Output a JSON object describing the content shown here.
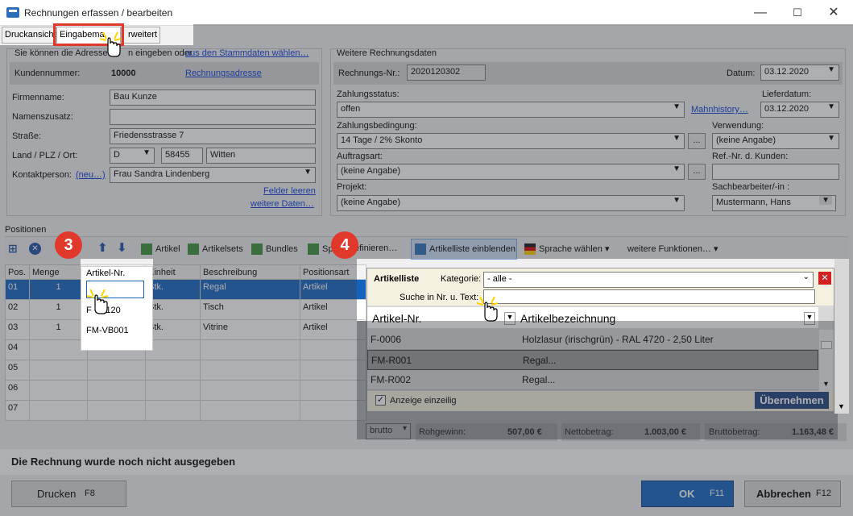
{
  "window": {
    "title": "Rechnungen erfassen / bearbeiten",
    "min": "—",
    "max": "☐",
    "close": "✕"
  },
  "tabs": [
    "Druckansicht",
    "Eingabemaske",
    "Erweitert"
  ],
  "tabs_visible": {
    "t1": "Druckansicht",
    "t2": "Eingabema",
    "t3": "rweitert"
  },
  "left": {
    "address_hint": "Sie können die Adresse",
    "address_hint2": "n eingeben oder",
    "stamm_link": "aus den Stammdaten wählen…",
    "kundennr_label": "Kundennummer:",
    "kundennr": "10000",
    "rechadr_link": "Rechnungsadresse",
    "firma_label": "Firmenname:",
    "firma": "Bau Kunze",
    "namenszusatz_label": "Namenszusatz:",
    "namenszusatz": "",
    "strasse_label": "Straße:",
    "strasse": "Friedensstrasse 7",
    "land_label": "Land / PLZ / Ort:",
    "land": "D",
    "plz": "58455",
    "ort": "Witten",
    "kontakt_label": "Kontaktperson:",
    "kontakt_link": "(neu…)",
    "kontakt": "Frau Sandra Lindenberg",
    "felder_leeren": "Felder leeren",
    "weitere_daten": "weitere Daten…"
  },
  "right": {
    "group_title": "Weitere Rechnungsdaten",
    "rechnr_label": "Rechnungs-Nr.:",
    "rechnr": "2020120302",
    "datum_label": "Datum:",
    "datum": "03.12.2020",
    "zahlstatus_label": "Zahlungsstatus:",
    "zahlstatus": "offen",
    "mahnhistory": "Mahnhistory…",
    "lieferdatum_label": "Lieferdatum:",
    "lieferdatum": "03.12.2020",
    "zahlbed_label": "Zahlungsbedingung:",
    "zahlbed": "14 Tage / 2% Skonto",
    "verwendung_label": "Verwendung:",
    "verwendung": "(keine Angabe)",
    "auftragsart_label": "Auftragsart:",
    "auftragsart": "(keine Angabe)",
    "refnr_label": "Ref.-Nr. d. Kunden:",
    "refnr": "",
    "projekt_label": "Projekt:",
    "projekt": "(keine Angabe)",
    "sachbearb_label": "Sachbearbeiter/-in :",
    "sachbearb": "Mustermann, Hans",
    "dots": "..."
  },
  "positions": {
    "title": "Positionen",
    "toolbar": {
      "artikel": "Artikel",
      "artikelsets": "Artikelsets",
      "bundles": "Bundles",
      "sp": "Sp",
      "definieren": "efinieren…",
      "artikelliste": "Artikelliste einblenden",
      "sprache": "Sprache wählen",
      "weitere": "weitere Funktionen…"
    },
    "columns": [
      "Pos.",
      "Menge",
      "Artikel-Nr.",
      "Einheit",
      "Beschreibung",
      "Positionsart"
    ],
    "rows": [
      {
        "pos": "01",
        "menge": "1",
        "artnr": "",
        "einheit": "Stk.",
        "beschr": "Regal",
        "art": "Artikel"
      },
      {
        "pos": "02",
        "menge": "1",
        "artnr": "F  -B-120",
        "einheit": "Stk.",
        "beschr": "Tisch",
        "art": "Artikel"
      },
      {
        "pos": "03",
        "menge": "1",
        "artnr": "FM-VB001",
        "einheit": "Stk.",
        "beschr": "Vitrine",
        "art": "Artikel"
      },
      {
        "pos": "04",
        "menge": "",
        "artnr": "",
        "einheit": "",
        "beschr": "",
        "art": ""
      },
      {
        "pos": "05",
        "menge": "",
        "artnr": "",
        "einheit": "",
        "beschr": "",
        "art": ""
      },
      {
        "pos": "06",
        "menge": "",
        "artnr": "",
        "einheit": "",
        "beschr": "",
        "art": ""
      },
      {
        "pos": "07",
        "menge": "",
        "artnr": "",
        "einheit": "",
        "beschr": "",
        "art": ""
      }
    ]
  },
  "artikelliste": {
    "title": "Artikelliste",
    "kategorie_label": "Kategorie:",
    "kategorie": "- alle -",
    "suche_label": "Suche in Nr. u. Text:",
    "suche": "",
    "col1": "Artikel-Nr.",
    "col2": "Artikelbezeichnung",
    "items": [
      {
        "nr": "F-0006",
        "bez": "Holzlasur (irischgrün) - RAL 4720 - 2,50 Liter"
      },
      {
        "nr": "FM-R001",
        "bez": "Regal..."
      },
      {
        "nr": "FM-R002",
        "bez": "Regal..."
      }
    ],
    "einzeln": "Anzeige einzeilig",
    "uebernehmen": "Übernehmen"
  },
  "totals": {
    "mode": "brutto",
    "rohgewinn_label": "Rohgewinn:",
    "rohgewinn": "507,00 €",
    "netto_label": "Nettobetrag:",
    "netto": "1.003,00 €",
    "brutto_label": "Bruttobetrag:",
    "brutto": "1.163,48 €"
  },
  "status": "Die Rechnung wurde noch nicht ausgegeben",
  "buttons": {
    "drucken": "Drucken",
    "drucken_key": "F8",
    "ok": "OK",
    "ok_key": "F11",
    "abbrechen": "Abbrechen",
    "abbrechen_key": "F12"
  },
  "callouts": {
    "b3": "3",
    "b4": "4"
  },
  "colors": {
    "accent": "#1462c0",
    "callout": "#e0392b",
    "link": "#0b3ad8"
  }
}
